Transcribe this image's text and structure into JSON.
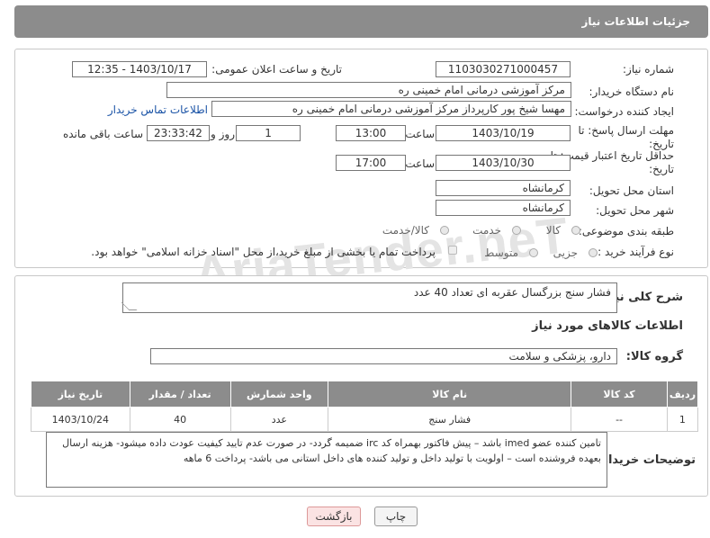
{
  "header": {
    "title": "جزئیات اطلاعات نیاز"
  },
  "form": {
    "need_number_label": "شماره نیاز:",
    "need_number": "1103030271000457",
    "announce_label": "تاریخ و ساعت اعلان عمومی:",
    "announce_value": "1403/10/17 - 12:35",
    "buyer_org_label": "نام دستگاه خریدار:",
    "buyer_org": "مرکز آموزشی درمانی امام خمینی ره",
    "creator_label": "ایجاد کننده درخواست:",
    "creator": "مهسا شیخ پور کارپرداز مرکز آموزشی درمانی امام خمینی ره",
    "contact_link": "اطلاعات تماس خریدار",
    "deadline_label": "مهلت ارسال پاسخ: تا تاریخ:",
    "deadline_date": "1403/10/19",
    "time_label": "ساعت",
    "deadline_time": "13:00",
    "days_value": "1",
    "days_label": "روز و",
    "remaining_time": "23:33:42",
    "remaining_label": "ساعت باقی مانده",
    "validity_label": "حداقل تاریخ اعتبار قیمت: تا تاریخ:",
    "validity_date": "1403/10/30",
    "validity_time": "17:00",
    "province_label": "استان محل تحویل:",
    "province": "کرمانشاه",
    "city_label": "شهر محل تحویل:",
    "city": "کرمانشاه",
    "category_label": "طبقه بندی موضوعی:",
    "category_options": [
      "کالا",
      "خدمت",
      "کالا/خدمت"
    ],
    "process_label": "نوع فرآیند خرید :",
    "process_options": [
      "جزیی",
      "متوسط"
    ],
    "payment_note": "پرداخت تمام یا بخشی از مبلغ خرید،از محل \"اسناد خزانه اسلامی\" خواهد بود."
  },
  "summary": {
    "description_label": "شرح کلی نیاز:",
    "description": "فشار سنج بزرگسال عقربه ای تعداد 40 عدد",
    "goods_info_title": "اطلاعات کالاهای مورد نیاز",
    "goods_group_label": "گروه کالا:",
    "goods_group": "دارو، پزشکی و سلامت"
  },
  "table": {
    "headers": [
      "ردیف",
      "کد کالا",
      "نام کالا",
      "واحد شمارش",
      "تعداد / مقدار",
      "تاریخ نیاز"
    ],
    "rows": [
      [
        "1",
        "--",
        "فشار سنج",
        "عدد",
        "40",
        "1403/10/24"
      ]
    ]
  },
  "buyer_notes": {
    "label": "توضیحات خریدار:",
    "text": "تامین کننده عضو imed باشد – پیش فاکتور بهمراه کد irc ضمیمه گردد- در صورت عدم تایید کیفیت عودت داده میشود- هزینه ارسال بعهده فروشنده است – اولویت با تولید داخل و تولید کننده های داخل استانی می باشد- پرداخت 6 ماهه"
  },
  "buttons": {
    "back": "بازگشت",
    "print": "چاپ"
  },
  "watermark": "AriaTender.neT"
}
